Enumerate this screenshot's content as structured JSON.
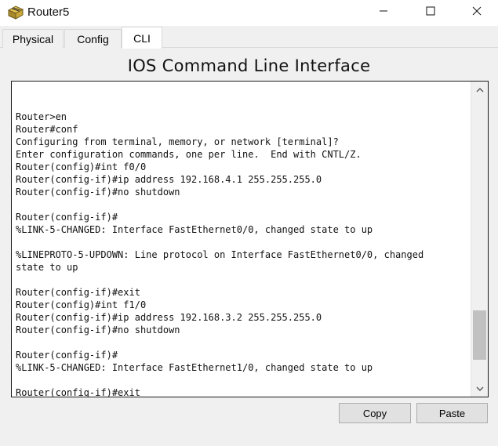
{
  "window": {
    "title": "Router5",
    "icon": "router-icon",
    "controls": [
      "minimize-icon",
      "maximize-icon",
      "close-icon"
    ]
  },
  "tabs": [
    {
      "label": "Physical",
      "active": false
    },
    {
      "label": "Config",
      "active": false
    },
    {
      "label": "CLI",
      "active": true
    }
  ],
  "heading": "IOS Command Line Interface",
  "terminal": {
    "lines": [
      "Router>en",
      "Router#conf",
      "Configuring from terminal, memory, or network [terminal]?",
      "Enter configuration commands, one per line.  End with CNTL/Z.",
      "Router(config)#int f0/0",
      "Router(config-if)#ip address 192.168.4.1 255.255.255.0",
      "Router(config-if)#no shutdown",
      "",
      "Router(config-if)#",
      "%LINK-5-CHANGED: Interface FastEthernet0/0, changed state to up",
      "",
      "%LINEPROTO-5-UPDOWN: Line protocol on Interface FastEthernet0/0, changed",
      "state to up",
      "",
      "Router(config-if)#exit",
      "Router(config)#int f1/0",
      "Router(config-if)#ip address 192.168.3.2 255.255.255.0",
      "Router(config-if)#no shutdown",
      "",
      "Router(config-if)#",
      "%LINK-5-CHANGED: Interface FastEthernet1/0, changed state to up",
      "",
      "Router(config-if)#exit"
    ]
  },
  "buttons": {
    "copy": "Copy",
    "paste": "Paste"
  },
  "colors": {
    "window_bg": "#f0f0f0",
    "terminal_bg": "#ffffff",
    "terminal_border": "#1a1a1a",
    "button_bg": "#e1e1e1"
  }
}
